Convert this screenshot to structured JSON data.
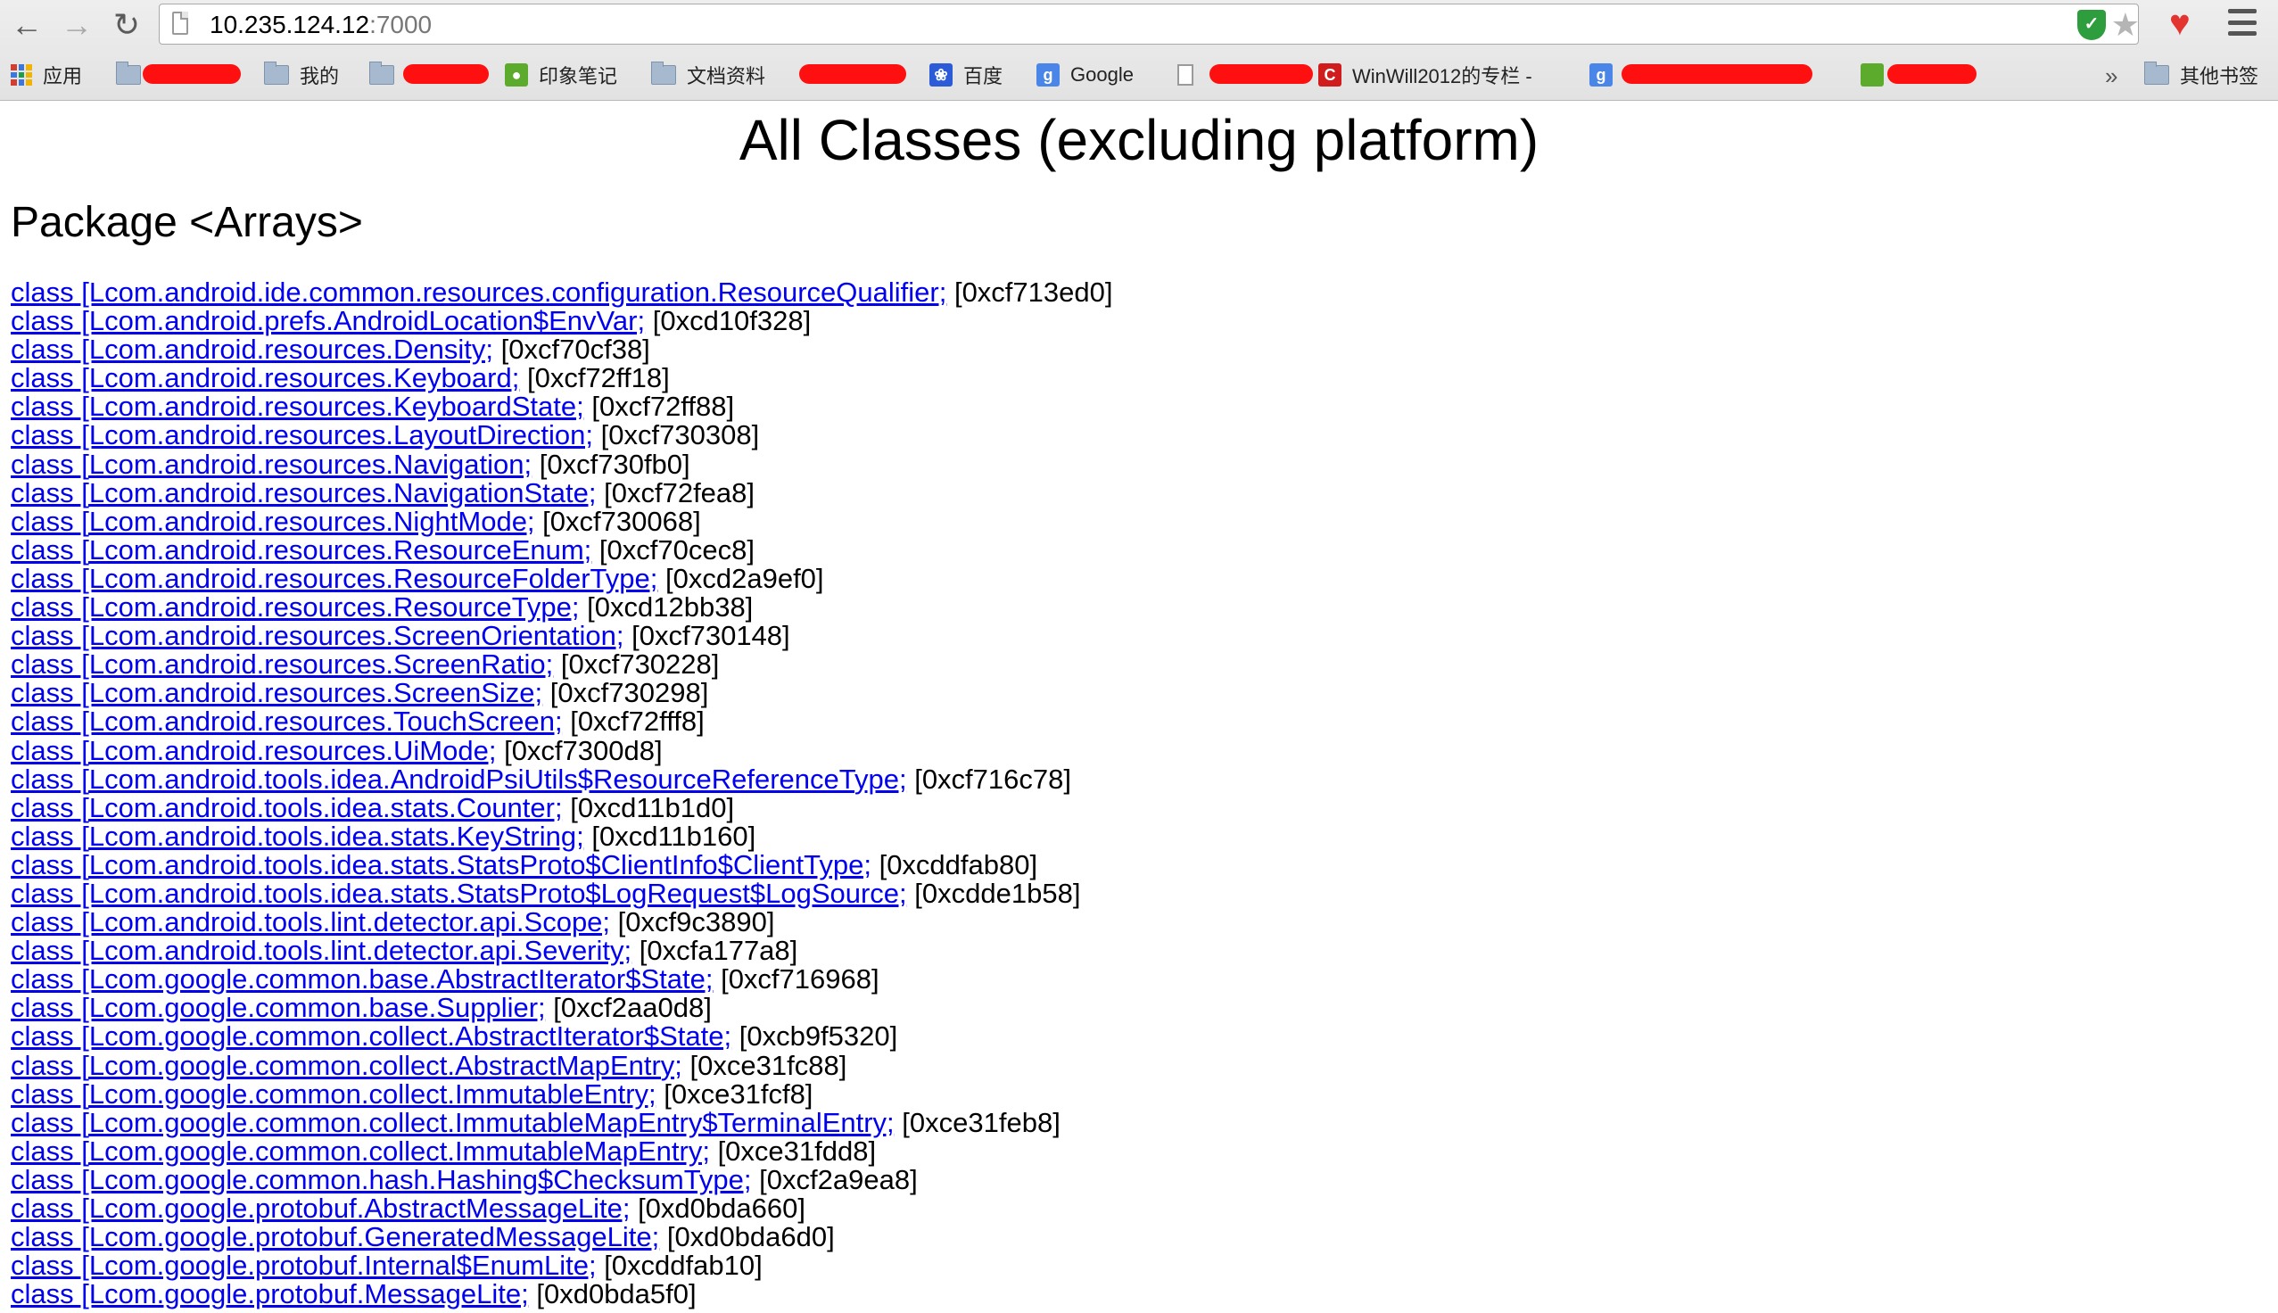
{
  "browser": {
    "url_host": "10.235.124.12",
    "url_port": ":7000",
    "shield_label": "✓",
    "bookmarks": [
      {
        "label": "应用"
      },
      {
        "label": "我的"
      },
      {
        "label": "印象笔记"
      },
      {
        "label": "文档资料"
      },
      {
        "label": "百度"
      },
      {
        "label": "Google"
      },
      {
        "label": "WinWill2012的专栏 -"
      },
      {
        "label": "其他书签"
      }
    ]
  },
  "page": {
    "title": "All Classes (excluding platform)",
    "package_heading": "Package <Arrays>",
    "classes": [
      {
        "name": "class [Lcom.android.ide.common.resources.configuration.ResourceQualifier;",
        "addr": "[0xcf713ed0]"
      },
      {
        "name": "class [Lcom.android.prefs.AndroidLocation$EnvVar;",
        "addr": "[0xcd10f328]"
      },
      {
        "name": "class [Lcom.android.resources.Density;",
        "addr": "[0xcf70cf38]"
      },
      {
        "name": "class [Lcom.android.resources.Keyboard;",
        "addr": "[0xcf72ff18]"
      },
      {
        "name": "class [Lcom.android.resources.KeyboardState;",
        "addr": "[0xcf72ff88]"
      },
      {
        "name": "class [Lcom.android.resources.LayoutDirection;",
        "addr": "[0xcf730308]"
      },
      {
        "name": "class [Lcom.android.resources.Navigation;",
        "addr": "[0xcf730fb0]"
      },
      {
        "name": "class [Lcom.android.resources.NavigationState;",
        "addr": "[0xcf72fea8]"
      },
      {
        "name": "class [Lcom.android.resources.NightMode;",
        "addr": "[0xcf730068]"
      },
      {
        "name": "class [Lcom.android.resources.ResourceEnum;",
        "addr": "[0xcf70cec8]"
      },
      {
        "name": "class [Lcom.android.resources.ResourceFolderType;",
        "addr": "[0xcd2a9ef0]"
      },
      {
        "name": "class [Lcom.android.resources.ResourceType;",
        "addr": "[0xcd12bb38]"
      },
      {
        "name": "class [Lcom.android.resources.ScreenOrientation;",
        "addr": "[0xcf730148]"
      },
      {
        "name": "class [Lcom.android.resources.ScreenRatio;",
        "addr": "[0xcf730228]"
      },
      {
        "name": "class [Lcom.android.resources.ScreenSize;",
        "addr": "[0xcf730298]"
      },
      {
        "name": "class [Lcom.android.resources.TouchScreen;",
        "addr": "[0xcf72fff8]"
      },
      {
        "name": "class [Lcom.android.resources.UiMode;",
        "addr": "[0xcf7300d8]"
      },
      {
        "name": "class [Lcom.android.tools.idea.AndroidPsiUtils$ResourceReferenceType;",
        "addr": "[0xcf716c78]"
      },
      {
        "name": "class [Lcom.android.tools.idea.stats.Counter;",
        "addr": "[0xcd11b1d0]"
      },
      {
        "name": "class [Lcom.android.tools.idea.stats.KeyString;",
        "addr": "[0xcd11b160]"
      },
      {
        "name": "class [Lcom.android.tools.idea.stats.StatsProto$ClientInfo$ClientType;",
        "addr": "[0xcddfab80]"
      },
      {
        "name": "class [Lcom.android.tools.idea.stats.StatsProto$LogRequest$LogSource;",
        "addr": "[0xcdde1b58]"
      },
      {
        "name": "class [Lcom.android.tools.lint.detector.api.Scope;",
        "addr": "[0xcf9c3890]"
      },
      {
        "name": "class [Lcom.android.tools.lint.detector.api.Severity;",
        "addr": "[0xcfa177a8]"
      },
      {
        "name": "class [Lcom.google.common.base.AbstractIterator$State;",
        "addr": "[0xcf716968]"
      },
      {
        "name": "class [Lcom.google.common.base.Supplier;",
        "addr": "[0xcf2aa0d8]"
      },
      {
        "name": "class [Lcom.google.common.collect.AbstractIterator$State;",
        "addr": "[0xcb9f5320]"
      },
      {
        "name": "class [Lcom.google.common.collect.AbstractMapEntry;",
        "addr": "[0xce31fc88]"
      },
      {
        "name": "class [Lcom.google.common.collect.ImmutableEntry;",
        "addr": "[0xce31fcf8]"
      },
      {
        "name": "class [Lcom.google.common.collect.ImmutableMapEntry$TerminalEntry;",
        "addr": "[0xce31feb8]"
      },
      {
        "name": "class [Lcom.google.common.collect.ImmutableMapEntry;",
        "addr": "[0xce31fdd8]"
      },
      {
        "name": "class [Lcom.google.common.hash.Hashing$ChecksumType;",
        "addr": "[0xcf2a9ea8]"
      },
      {
        "name": "class [Lcom.google.protobuf.AbstractMessageLite;",
        "addr": "[0xd0bda660]"
      },
      {
        "name": "class [Lcom.google.protobuf.GeneratedMessageLite;",
        "addr": "[0xd0bda6d0]"
      },
      {
        "name": "class [Lcom.google.protobuf.Internal$EnumLite;",
        "addr": "[0xcddfab10]"
      },
      {
        "name": "class [Lcom.google.protobuf.MessageLite;",
        "addr": "[0xd0bda5f0]"
      }
    ]
  }
}
